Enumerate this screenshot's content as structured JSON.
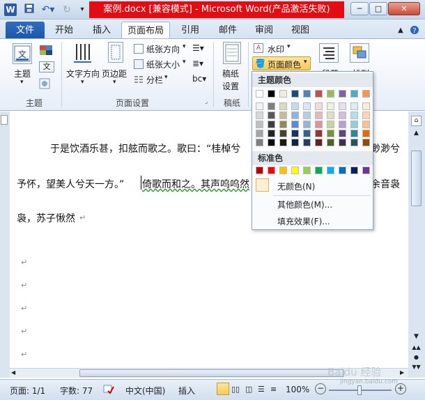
{
  "window": {
    "title": "案例.docx [兼容模式] - Microsoft Word(产品激活失败)",
    "app_icon": "W",
    "controls": {
      "minimize": "─",
      "maximize": "□",
      "close": "✕"
    }
  },
  "tabs": [
    {
      "label": "文件"
    },
    {
      "label": "开始"
    },
    {
      "label": "插入"
    },
    {
      "label": "页面布局"
    },
    {
      "label": "引用"
    },
    {
      "label": "邮件"
    },
    {
      "label": "审阅"
    },
    {
      "label": "视图"
    }
  ],
  "ribbon": {
    "theme_group": {
      "theme_label": "主题",
      "group_label": "主题"
    },
    "page_setup": {
      "text_direction": "文字方向",
      "margins": "页边距",
      "orientation": "纸张方向",
      "size": "纸张大小",
      "columns": "分栏",
      "group_label": "页面设置"
    },
    "paper": {
      "label": "稿纸设置",
      "line1": "稿纸",
      "line2": "设置",
      "group_label": "稿纸"
    },
    "background": {
      "watermark": "水印",
      "page_color": "页面颜色"
    },
    "paragraph": {
      "label": "段落"
    },
    "arrange": {
      "label": "排列"
    }
  },
  "color_menu": {
    "theme_colors_header": "主题颜色",
    "standard_colors_header": "标准色",
    "no_color": "无颜色(N)",
    "more_colors": "其他颜色(M)...",
    "fill_effects": "填充效果(F)...",
    "theme_row": [
      "#ffffff",
      "#000000",
      "#eeece1",
      "#1f497d",
      "#4f81bd",
      "#c0504d",
      "#9bbb59",
      "#8064a2",
      "#4bacc6",
      "#f79646"
    ],
    "shade_rows": [
      [
        "#f2f2f2",
        "#7f7f7f",
        "#ddd9c3",
        "#c6d9f0",
        "#dbe5f1",
        "#f2dcdb",
        "#ebf1dd",
        "#e5e0ec",
        "#dbeef3",
        "#fdeada"
      ],
      [
        "#d8d8d8",
        "#595959",
        "#c4bd97",
        "#8db3e2",
        "#b8cce4",
        "#e5b9b7",
        "#d7e3bc",
        "#ccc1d9",
        "#b7dde8",
        "#fbd5b5"
      ],
      [
        "#bfbfbf",
        "#3f3f3f",
        "#938953",
        "#548dd4",
        "#95b3d7",
        "#d99694",
        "#c3d69b",
        "#b2a2c7",
        "#92cddc",
        "#fac08f"
      ],
      [
        "#a5a5a5",
        "#262626",
        "#494429",
        "#17365d",
        "#366092",
        "#953734",
        "#76923c",
        "#5f497a",
        "#31859b",
        "#e36c09"
      ],
      [
        "#7f7f7f",
        "#0c0c0c",
        "#1d1b10",
        "#0f243e",
        "#244061",
        "#632423",
        "#4f6128",
        "#3f3151",
        "#205867",
        "#974806"
      ]
    ],
    "standard_row": [
      "#c00000",
      "#ff0000",
      "#ffc000",
      "#ffff00",
      "#92d050",
      "#00b050",
      "#00b0f0",
      "#0070c0",
      "#002060",
      "#7030a0"
    ]
  },
  "document": {
    "line1": "于是饮酒乐甚，扣舷而歌之。歌曰：“桂棹兮",
    "line1_end": "渺渺兮",
    "line2_start": "予怀，望美人兮天一方。”",
    "line2_mid": "倚歌而和之。其声呜呜然",
    "line2_end": "余音袅",
    "line3": "袅，苏子愀然",
    "para_mark": "↵"
  },
  "status": {
    "page": "页面: 1/1",
    "words": "字数: 77",
    "language": "中文(中国)",
    "mode": "插入",
    "zoom": "100%",
    "watermark_text": "Baidu 经验",
    "watermark_url": "jingyan.baidu.com"
  }
}
